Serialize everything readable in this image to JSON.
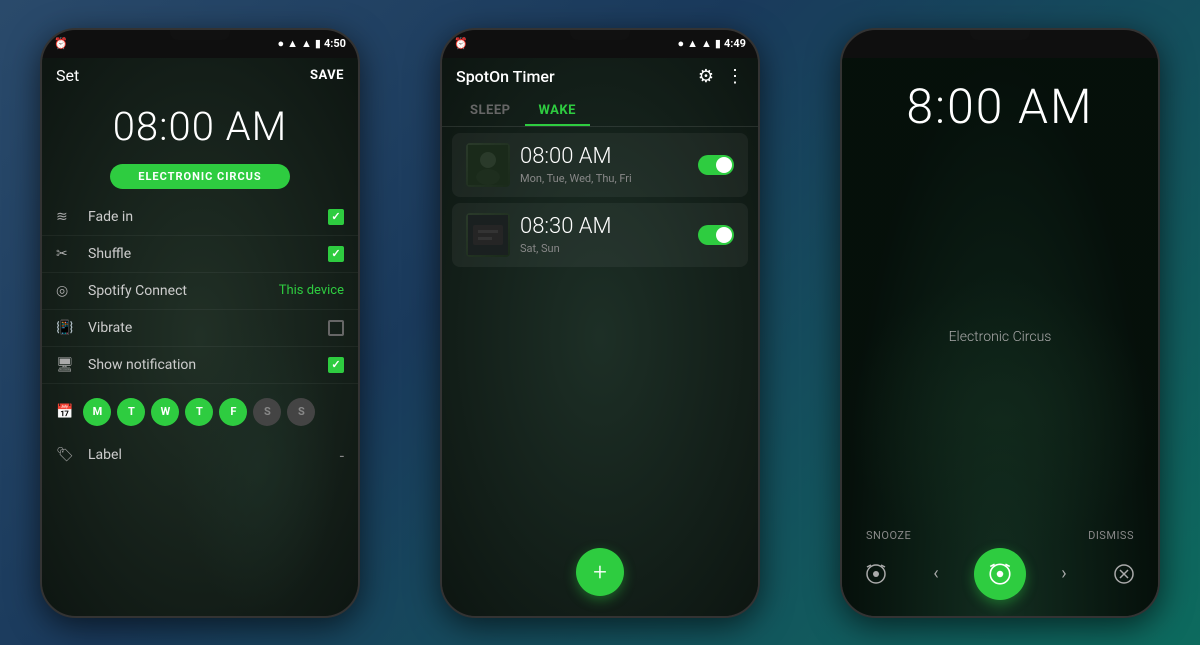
{
  "phone1": {
    "status": {
      "left_icon": "⏰",
      "right_icons": "● ▲ ▲ ▮",
      "time": "4:50"
    },
    "header": {
      "title": "Set",
      "save": "SAVE"
    },
    "alarm_time": "08:00 AM",
    "song_name": "ELECTRONIC CIRCUS",
    "settings": [
      {
        "icon": "🎵",
        "label": "Fade in",
        "value": "",
        "checked": true,
        "type": "checkbox"
      },
      {
        "icon": "✂",
        "label": "Shuffle",
        "value": "",
        "checked": true,
        "type": "checkbox"
      },
      {
        "icon": "🔊",
        "label": "Spotify Connect",
        "value": "This device",
        "checked": false,
        "type": "value"
      },
      {
        "icon": "📳",
        "label": "Vibrate",
        "value": "",
        "checked": false,
        "type": "checkbox"
      },
      {
        "icon": "🖥",
        "label": "Show notification",
        "value": "",
        "checked": true,
        "type": "checkbox"
      }
    ],
    "days": [
      {
        "letter": "M",
        "active": true
      },
      {
        "letter": "T",
        "active": true
      },
      {
        "letter": "W",
        "active": true
      },
      {
        "letter": "T",
        "active": true
      },
      {
        "letter": "F",
        "active": true
      },
      {
        "letter": "S",
        "active": false
      },
      {
        "letter": "S",
        "active": false
      }
    ],
    "label": "Label",
    "label_dash": "-"
  },
  "phone2": {
    "status": {
      "left_icon": "⏰",
      "time": "4:49"
    },
    "header": {
      "title": "SpotOn Timer"
    },
    "tabs": [
      {
        "label": "SLEEP",
        "active": false
      },
      {
        "label": "WAKE",
        "active": true
      }
    ],
    "alarms": [
      {
        "time": "08:00 AM",
        "days": "Mon, Tue, Wed, Thu, Fri",
        "enabled": true
      },
      {
        "time": "08:30 AM",
        "days": "Sat, Sun",
        "enabled": true
      }
    ],
    "fab_label": "+"
  },
  "phone3": {
    "status": {
      "time": ""
    },
    "alarm_time": "8:00 AM",
    "song_name": "Electronic Circus",
    "snooze_label": "SNOOZE",
    "dismiss_label": "DISMISS"
  },
  "colors": {
    "green": "#2ecc40",
    "dark_bg": "#1c1c1c",
    "text_white": "#ffffff",
    "text_gray": "#aaaaaa",
    "text_muted": "#666666"
  }
}
